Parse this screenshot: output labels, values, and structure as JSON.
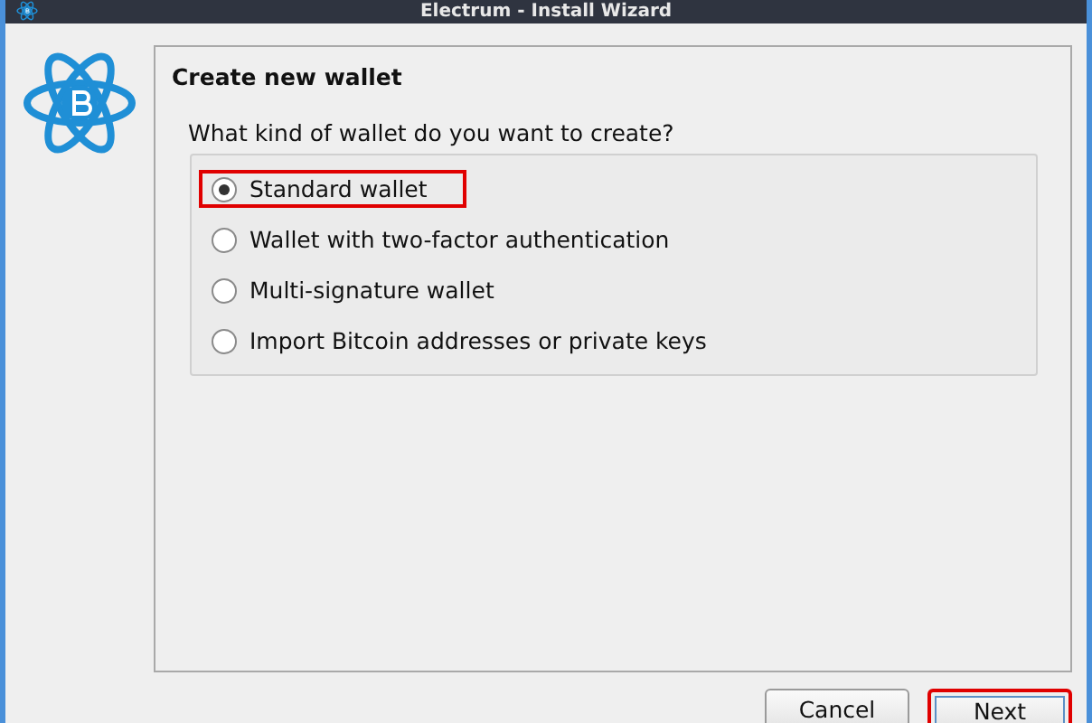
{
  "window": {
    "title": "Electrum  -  Install Wizard"
  },
  "page": {
    "heading": "Create new wallet",
    "question": "What kind of wallet do you want to create?"
  },
  "options": [
    {
      "label": "Standard wallet",
      "selected": true,
      "highlighted": true
    },
    {
      "label": "Wallet with two-factor authentication",
      "selected": false,
      "highlighted": false
    },
    {
      "label": "Multi-signature wallet",
      "selected": false,
      "highlighted": false
    },
    {
      "label": "Import Bitcoin addresses or private keys",
      "selected": false,
      "highlighted": false
    }
  ],
  "buttons": [
    {
      "label": "Cancel",
      "highlighted": false
    },
    {
      "label": "Next",
      "highlighted": true
    }
  ]
}
